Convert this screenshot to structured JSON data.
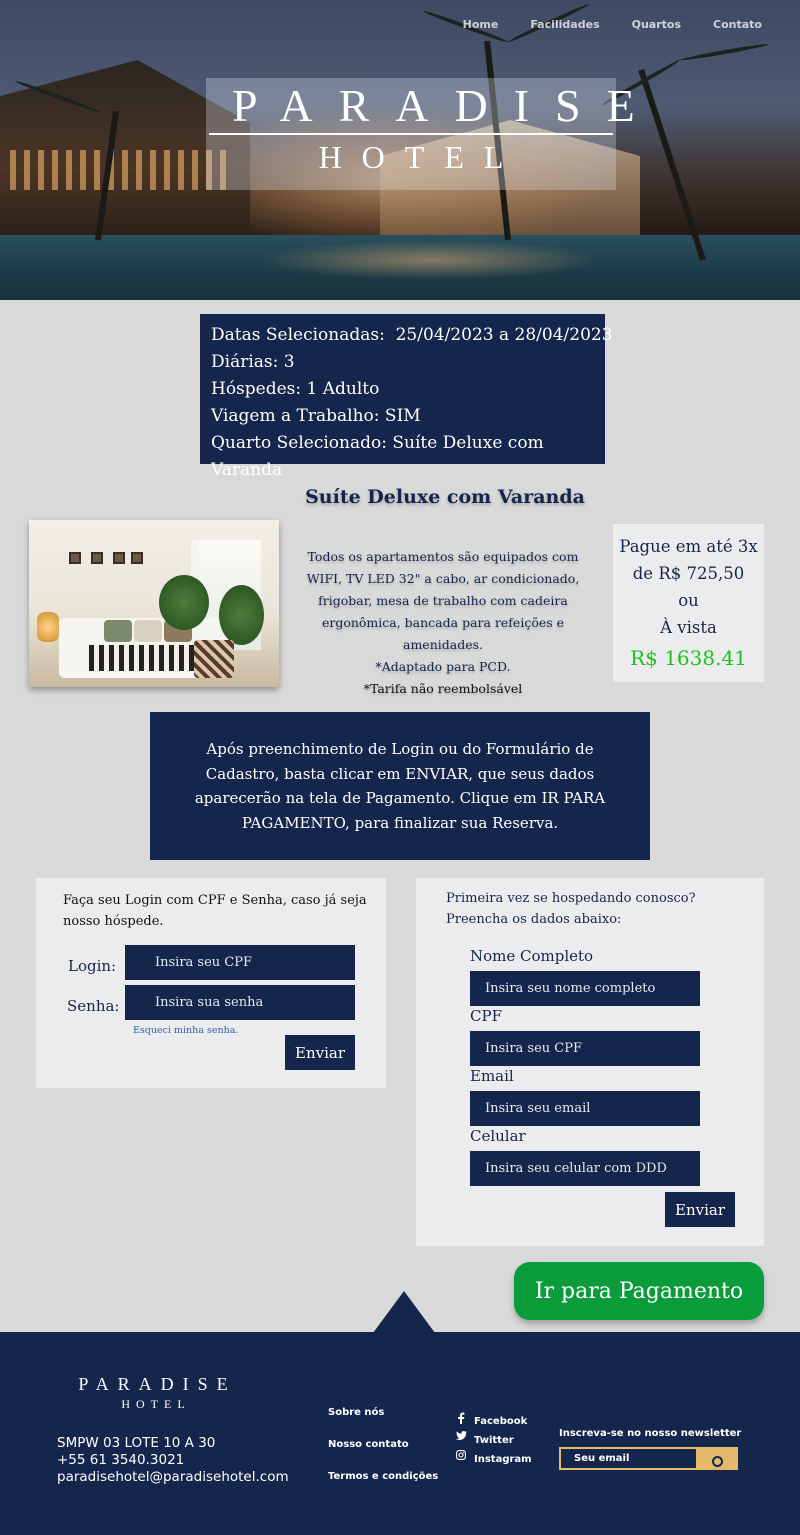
{
  "nav": {
    "home": "Home",
    "facilities": "Facilidades",
    "rooms": "Quartos",
    "contact": "Contato"
  },
  "hero": {
    "logo_big": "PARADISE",
    "logo_small": "HOTEL"
  },
  "summary": {
    "dates": "Datas Selecionadas:  25/04/2023 a 28/04/2023",
    "nights": "Diárias: 3",
    "guests": "Hóspedes: 1 Adulto",
    "business": "Viagem a Trabalho: SIM",
    "room": "Quarto Selecionado: Suíte Deluxe com Varanda"
  },
  "room": {
    "title": "Suíte Deluxe com Varanda",
    "description": "Todos os apartamentos são equipados com WIFI, TV LED 32\" a cabo, ar condicionado, frigobar, mesa de trabalho com cadeira ergonômica, bancada para refeições e amenidades.",
    "pcd": "*Adaptado para PCD.",
    "non_refundable": "*Tarifa não reembolsável"
  },
  "price": {
    "installments_line1": "Pague em até 3x",
    "installments_line2": "de R$ 725,50",
    "or": "ou",
    "cash": "À vista",
    "total": "R$ 1638.41",
    "total_color": "#1ec21e"
  },
  "info": "Após preenchimento de Login ou do Formulário de Cadastro, basta clicar em ENVIAR, que seus dados aparecerão na tela de Pagamento. Clique em IR PARA PAGAMENTO, para finalizar sua Reserva.",
  "login": {
    "intro": "Faça seu Login com CPF e Senha, caso já seja nosso hóspede.",
    "login_label": "Login:",
    "login_placeholder": "Insira seu CPF",
    "password_label": "Senha:",
    "password_placeholder": "Insira sua senha",
    "forgot": "Esqueci minha senha.",
    "submit": "Enviar"
  },
  "register": {
    "intro": "Primeira vez se hospedando conosco? Preencha os dados abaixo:",
    "name_label": "Nome Completo",
    "name_placeholder": "Insira seu nome completo",
    "cpf_label": "CPF",
    "cpf_placeholder": "Insira seu CPF",
    "email_label": "Email",
    "email_placeholder": "Insira seu email",
    "phone_label": "Celular",
    "phone_placeholder": "Insira seu celular com DDD",
    "submit": "Enviar"
  },
  "payment_button": "Ir para Pagamento",
  "footer": {
    "logo_big": "PARADISE",
    "logo_small": "HOTEL",
    "address": "SMPW 03 LOTE 10 A 30",
    "phone": "+55 61 3540.3021",
    "email": "paradisehotel@paradisehotel.com",
    "links": [
      "Sobre nós",
      "Nosso contato",
      "Termos e condições"
    ],
    "social": [
      {
        "icon": "facebook-icon",
        "label": "Facebook"
      },
      {
        "icon": "twitter-icon",
        "label": "Twitter"
      },
      {
        "icon": "instagram-icon",
        "label": "Instagram"
      }
    ],
    "newsletter_title": "Inscreva-se no nosso newsletter",
    "newsletter_placeholder": "Seu email"
  },
  "colors": {
    "navy": "#15264d",
    "accent_green": "#0a9b3b",
    "price_green": "#1ec21e",
    "gold": "#e5b96c",
    "background": "#d9d9d9"
  }
}
